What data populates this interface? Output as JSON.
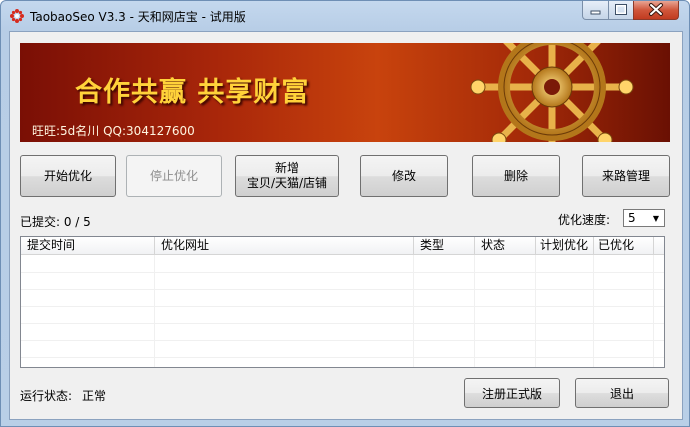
{
  "window": {
    "title": "TaobaoSeo V3.3 - 天和网店宝 - 试用版",
    "accent": "#3b70a8"
  },
  "banner": {
    "slogan": "合作共赢  共享财富",
    "contact": "旺旺:5d名川  QQ:304127600"
  },
  "toolbar": {
    "start_label": "开始优化",
    "stop_label": "停止优化",
    "add_label_line1": "新增",
    "add_label_line2": "宝贝/天猫/店铺",
    "edit_label": "修改",
    "delete_label": "删除",
    "source_label": "来路管理"
  },
  "stats": {
    "submitted": "已提交: 0 / 5",
    "speed_label": "优化速度:",
    "speed_value": "5"
  },
  "table": {
    "columns": [
      "提交时间",
      "优化网址",
      "类型",
      "状态",
      "计划优化",
      "已优化"
    ],
    "rows": []
  },
  "footer": {
    "status_label": "运行状态:",
    "status_value": "正常",
    "register_label": "注册正式版",
    "exit_label": "退出"
  }
}
